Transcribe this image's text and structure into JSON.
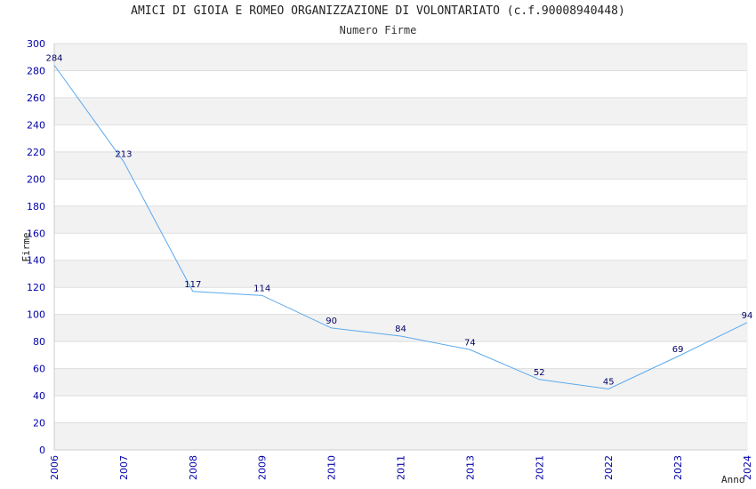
{
  "chart_data": {
    "type": "line",
    "title": "AMICI DI GIOIA E ROMEO ORGANIZZAZIONE DI VOLONTARIATO (c.f.90008940448)",
    "subtitle": "Numero Firme",
    "xlabel": "Anno",
    "ylabel": "Firme",
    "categories": [
      "2006",
      "2007",
      "2008",
      "2009",
      "2010",
      "2011",
      "2013",
      "2021",
      "2022",
      "2023",
      "2024"
    ],
    "series": [
      {
        "values": [
          284,
          213,
          117,
          114,
          90,
          84,
          74,
          52,
          45,
          69,
          94
        ]
      }
    ],
    "ylim": [
      0,
      300
    ],
    "yticks": [
      0,
      20,
      40,
      60,
      80,
      100,
      120,
      140,
      160,
      180,
      200,
      220,
      240,
      260,
      280,
      300
    ],
    "grid": true,
    "colors": {
      "line": "#5aa9ee",
      "band": "#f2f2f2",
      "tick_text": "#0000aa",
      "data_label": "#000066"
    }
  }
}
